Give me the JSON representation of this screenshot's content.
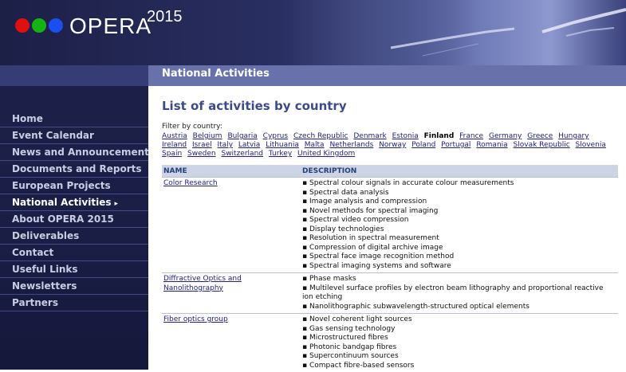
{
  "header": {
    "logo_text": "OPERA",
    "logo_year": "2015",
    "dot_colors": [
      "#e01010",
      "#14b414",
      "#1a4ff0"
    ]
  },
  "sidebar": {
    "items": [
      {
        "label": "Home"
      },
      {
        "label": "Event Calendar"
      },
      {
        "label": "News and Announcements"
      },
      {
        "label": "Documents and Reports"
      },
      {
        "label": "European Projects"
      },
      {
        "label": "National Activities",
        "active": true
      },
      {
        "label": "About OPERA 2015"
      },
      {
        "label": "Deliverables"
      },
      {
        "label": "Contact"
      },
      {
        "label": "Useful Links"
      },
      {
        "label": "Newsletters"
      },
      {
        "label": "Partners"
      }
    ],
    "active_arrow": "▸"
  },
  "section": {
    "title": "National Activities"
  },
  "main": {
    "title": "List of activities by country",
    "filter_label": "Filter by country:",
    "countries": [
      "Austria",
      "Belgium",
      "Bulgaria",
      "Cyprus",
      "Czech Republic",
      "Denmark",
      "Estonia",
      "Finland",
      "France",
      "Germany",
      "Greece",
      "Hungary",
      "Ireland",
      "Israel",
      "Italy",
      "Latvia",
      "Lithuania",
      "Malta",
      "Netherlands",
      "Norway",
      "Poland",
      "Portugal",
      "Romania",
      "Slovak Republic",
      "Slovenia",
      "Spain",
      "Sweden",
      "Switzerland",
      "Turkey",
      "United Kingdom"
    ],
    "current_country": "Finland",
    "table": {
      "headers": {
        "name": "NAME",
        "description": "DESCRIPTION"
      },
      "rows": [
        {
          "name": "Color Research",
          "items": [
            "Spectral colour signals in accurate colour measurements",
            "Spectral data analysis",
            "Image analysis and compression",
            "Novel methods for spectral imaging",
            "Spectral video compression",
            "Display technologies",
            "Resolution in spectral measurement",
            "Compression of digital archive image",
            "Spectral face image recognition method",
            "Spectral imaging systems and software"
          ]
        },
        {
          "name": "Diffractive Optics and Nanolithography",
          "items": [
            "Phase masks",
            "Multilevel surface profiles by electron beam lithography and proportional reactive ion etching",
            "Nanolithographic subwavelength-structured optical elements"
          ]
        },
        {
          "name": "Fiber optics group",
          "items": [
            "Novel coherent light sources",
            "Gas sensing technology",
            "Microstructured fibres",
            "Photonic bandgap fibres",
            "Supercontinuum sources",
            "Compact fibre-based sensors"
          ]
        }
      ],
      "bullet": "▪"
    }
  },
  "colors": {
    "nav_bg": "#1a1d44",
    "band": "#6871aa",
    "link": "#20208a",
    "title": "#3b4a8a",
    "table_header": "#ccd4e6"
  }
}
